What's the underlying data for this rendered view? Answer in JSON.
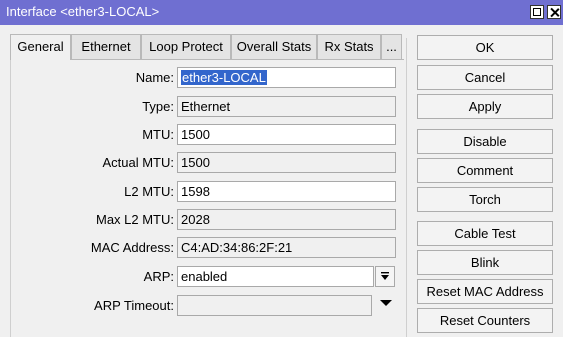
{
  "window": {
    "title": "Interface <ether3-LOCAL>"
  },
  "tabs": [
    {
      "label": "General",
      "active": true
    },
    {
      "label": "Ethernet"
    },
    {
      "label": "Loop Protect"
    },
    {
      "label": "Overall Stats"
    },
    {
      "label": "Rx Stats"
    },
    {
      "label": "..."
    }
  ],
  "fields": {
    "name": {
      "label": "Name:",
      "value": "ether3-LOCAL"
    },
    "type": {
      "label": "Type:",
      "value": "Ethernet"
    },
    "mtu": {
      "label": "MTU:",
      "value": "1500"
    },
    "actual_mtu": {
      "label": "Actual MTU:",
      "value": "1500"
    },
    "l2_mtu": {
      "label": "L2 MTU:",
      "value": "1598"
    },
    "max_l2_mtu": {
      "label": "Max L2 MTU:",
      "value": "2028"
    },
    "mac": {
      "label": "MAC Address:",
      "value": "C4:AD:34:86:2F:21"
    },
    "arp": {
      "label": "ARP:",
      "value": "enabled"
    },
    "arp_timeout": {
      "label": "ARP Timeout:",
      "value": ""
    }
  },
  "buttons": {
    "ok": "OK",
    "cancel": "Cancel",
    "apply": "Apply",
    "disable": "Disable",
    "comment": "Comment",
    "torch": "Torch",
    "cable_test": "Cable Test",
    "blink": "Blink",
    "reset_mac": "Reset MAC Address",
    "reset_counters": "Reset Counters"
  },
  "icons": {
    "dropdown_arrow": "dropdown-arrow-icon",
    "combo_arrow": "combo-dropdown-icon",
    "maximize": "maximize-icon",
    "close": "close-icon"
  },
  "colors": {
    "titlebar": "#6f6fd1",
    "selection": "#3366cc",
    "window_bg": "#f0f0f0"
  }
}
